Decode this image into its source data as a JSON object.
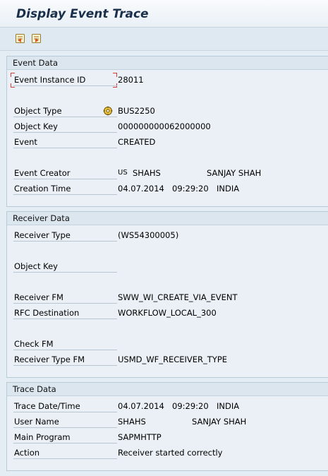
{
  "window": {
    "title": "Display Event Trace"
  },
  "toolbar": {
    "icons": [
      "previous-entry-icon",
      "next-entry-icon"
    ]
  },
  "event_data": {
    "header": "Event Data",
    "instance_id_label": "Event Instance ID",
    "instance_id": "28011",
    "object_type_label": "Object Type",
    "object_type": "BUS2250",
    "object_key_label": "Object Key",
    "object_key": "000000000062000000",
    "event_label": "Event",
    "event": "CREATED",
    "creator_label": "Event Creator",
    "creator_type": "US",
    "creator_id": "SHAHS",
    "creator_name": "SANJAY SHAH",
    "creation_time_label": "Creation Time",
    "creation_date": "04.07.2014",
    "creation_time": "09:29:20",
    "creation_tz": "INDIA"
  },
  "receiver_data": {
    "header": "Receiver Data",
    "receiver_type_label": "Receiver Type",
    "receiver_type": "(WS54300005)",
    "object_key_label": "Object Key",
    "object_key": "",
    "receiver_fm_label": "Receiver FM",
    "receiver_fm": "SWW_WI_CREATE_VIA_EVENT",
    "rfc_label": "RFC Destination",
    "rfc": "WORKFLOW_LOCAL_300",
    "check_fm_label": "Check FM",
    "check_fm": "",
    "receiver_type_fm_label": "Receiver Type FM",
    "receiver_type_fm": "USMD_WF_RECEIVER_TYPE"
  },
  "trace_data": {
    "header": "Trace Data",
    "datetime_label": "Trace Date/Time",
    "trace_date": "04.07.2014",
    "trace_time": "09:29:20",
    "trace_tz": "INDIA",
    "user_label": "User Name",
    "user_id": "SHAHS",
    "user_name": "SANJAY SHAH",
    "program_label": "Main Program",
    "program": "SAPMHTTP",
    "action_label": "Action",
    "action": "Receiver started correctly"
  }
}
